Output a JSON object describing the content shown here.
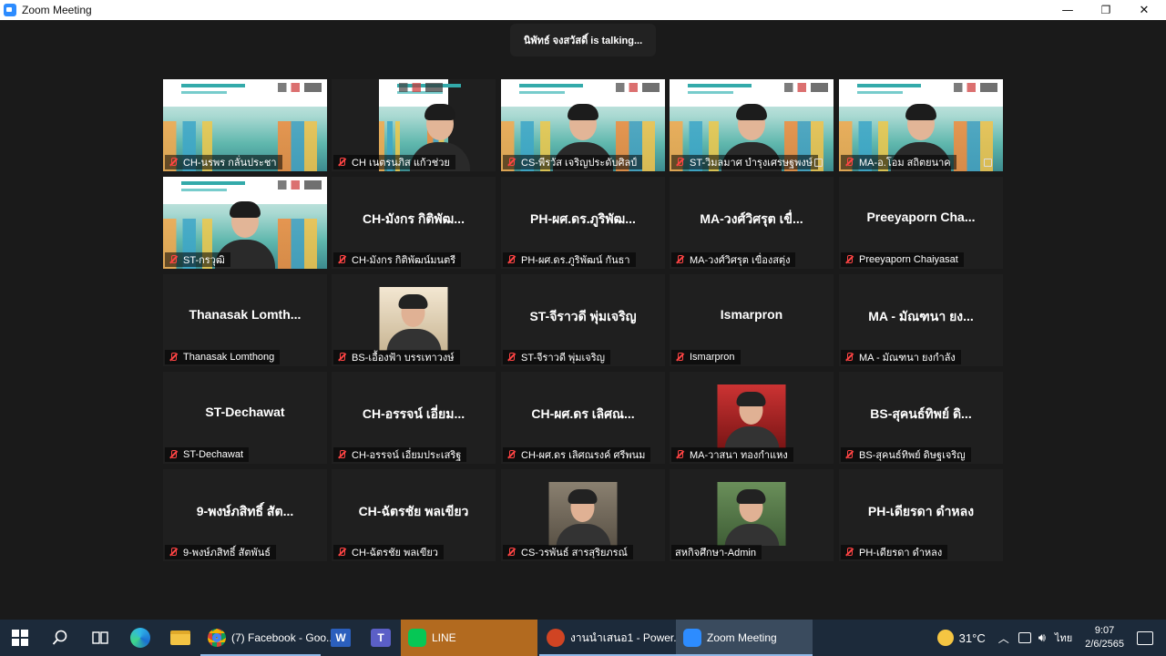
{
  "window": {
    "title": "Zoom Meeting",
    "minimize": "—",
    "restore": "❐",
    "close": "✕"
  },
  "meeting": {
    "talking": "นิพัทธ์ จงสวัสดิ์ is talking..."
  },
  "participants": [
    {
      "display": "",
      "label": "CH-นรพร กลั่นประชา",
      "video": true,
      "muted": true
    },
    {
      "display": "",
      "label": "CH เนตรนภิส แก้วช่วย",
      "video": true,
      "muted": true
    },
    {
      "display": "",
      "label": "CS-พีรวัส เจริญประดับศิลป์",
      "video": true,
      "muted": true
    },
    {
      "display": "",
      "label": "ST-วิมลมาศ บำรุงเศรษฐพงษ์",
      "video": true,
      "muted": true
    },
    {
      "display": "",
      "label": "MA-อ.โอม สถิตยนาค",
      "video": true,
      "muted": true
    },
    {
      "display": "",
      "label": "ST-กรวุฒิ",
      "video": true,
      "muted": true
    },
    {
      "display": "CH-มังกร กิติพัฒ...",
      "label": "CH-มังกร กิติพัฒน์มนตรี",
      "video": false,
      "muted": true
    },
    {
      "display": "PH-ผศ.ดร.ภูริพัฒ...",
      "label": "PH-ผศ.ดร.ภูริพัฒน์ กันธา",
      "video": false,
      "muted": true
    },
    {
      "display": "MA-วงศ์วิศรุต เขื่...",
      "label": "MA-วงศ์วิศรุต เขื่องสตุ่ง",
      "video": false,
      "muted": true
    },
    {
      "display": "Preeyaporn Cha...",
      "label": "Preeyaporn Chaiyasat",
      "video": false,
      "muted": true
    },
    {
      "display": "Thanasak Lomth...",
      "label": "Thanasak Lomthong",
      "video": false,
      "muted": true
    },
    {
      "display": "",
      "label": "BS-เอื้องฟ้า บรรเทาวงษ์",
      "video": false,
      "photo": true,
      "muted": true
    },
    {
      "display": "ST-จีราวดี พุ่มเจริญ",
      "label": "ST-จีราวดี พุ่มเจริญ",
      "video": false,
      "muted": true
    },
    {
      "display": "Ismarpron",
      "label": "Ismarpron",
      "video": false,
      "muted": true
    },
    {
      "display": "MA - มัณฑนา ยง...",
      "label": "MA - มัณฑนา ยงกำลัง",
      "video": false,
      "muted": true
    },
    {
      "display": "ST-Dechawat",
      "label": "ST-Dechawat",
      "video": false,
      "muted": true
    },
    {
      "display": "CH-อรรจน์ เอี่ยม...",
      "label": "CH-อรรจน์ เอี่ยมประเสริฐ",
      "video": false,
      "muted": true
    },
    {
      "display": "CH-ผศ.ดร เลิศณ...",
      "label": "CH-ผศ.ดร เลิศณรงค์ ศรีพนม",
      "video": false,
      "muted": true
    },
    {
      "display": "",
      "label": "MA-วาสนา ทองกำแหง",
      "video": false,
      "photo": true,
      "muted": true
    },
    {
      "display": "BS-สุคนธ์ทิพย์ ดิ...",
      "label": "BS-สุคนธ์ทิพย์ ดิษฐเจริญ",
      "video": false,
      "muted": true
    },
    {
      "display": "9-พงษ์ภสิทธิ์ สัต...",
      "label": "9-พงษ์ภสิทธิ์ สัตพันธ์",
      "video": false,
      "muted": true
    },
    {
      "display": "CH-ฉัตรชัย พลเขียว",
      "label": "CH-ฉัตรชัย พลเขียว",
      "video": false,
      "muted": true
    },
    {
      "display": "",
      "label": "CS-วรพันธ์ สารสุริยภรณ์",
      "video": false,
      "photo": true,
      "muted": true
    },
    {
      "display": "",
      "label": "สหกิจศึกษา-Admin",
      "video": false,
      "photo": true,
      "muted": false
    },
    {
      "display": "PH-เดียรดา ดำหลง",
      "label": "PH-เดียรดา ดำหลง",
      "video": false,
      "muted": true
    }
  ],
  "taskbar": {
    "apps": [
      {
        "label": "(7) Facebook - Goo...",
        "icon": "chrome-icon"
      },
      {
        "label": "LINE",
        "icon": "line-icon"
      },
      {
        "label": "งานนำเสนอ1 - Power...",
        "icon": "powerpoint-icon"
      },
      {
        "label": "Zoom Meeting",
        "icon": "zoom-icon"
      }
    ],
    "weather": "31°C",
    "language": "ไทย",
    "time": "9:07",
    "date": "2/6/2565"
  }
}
